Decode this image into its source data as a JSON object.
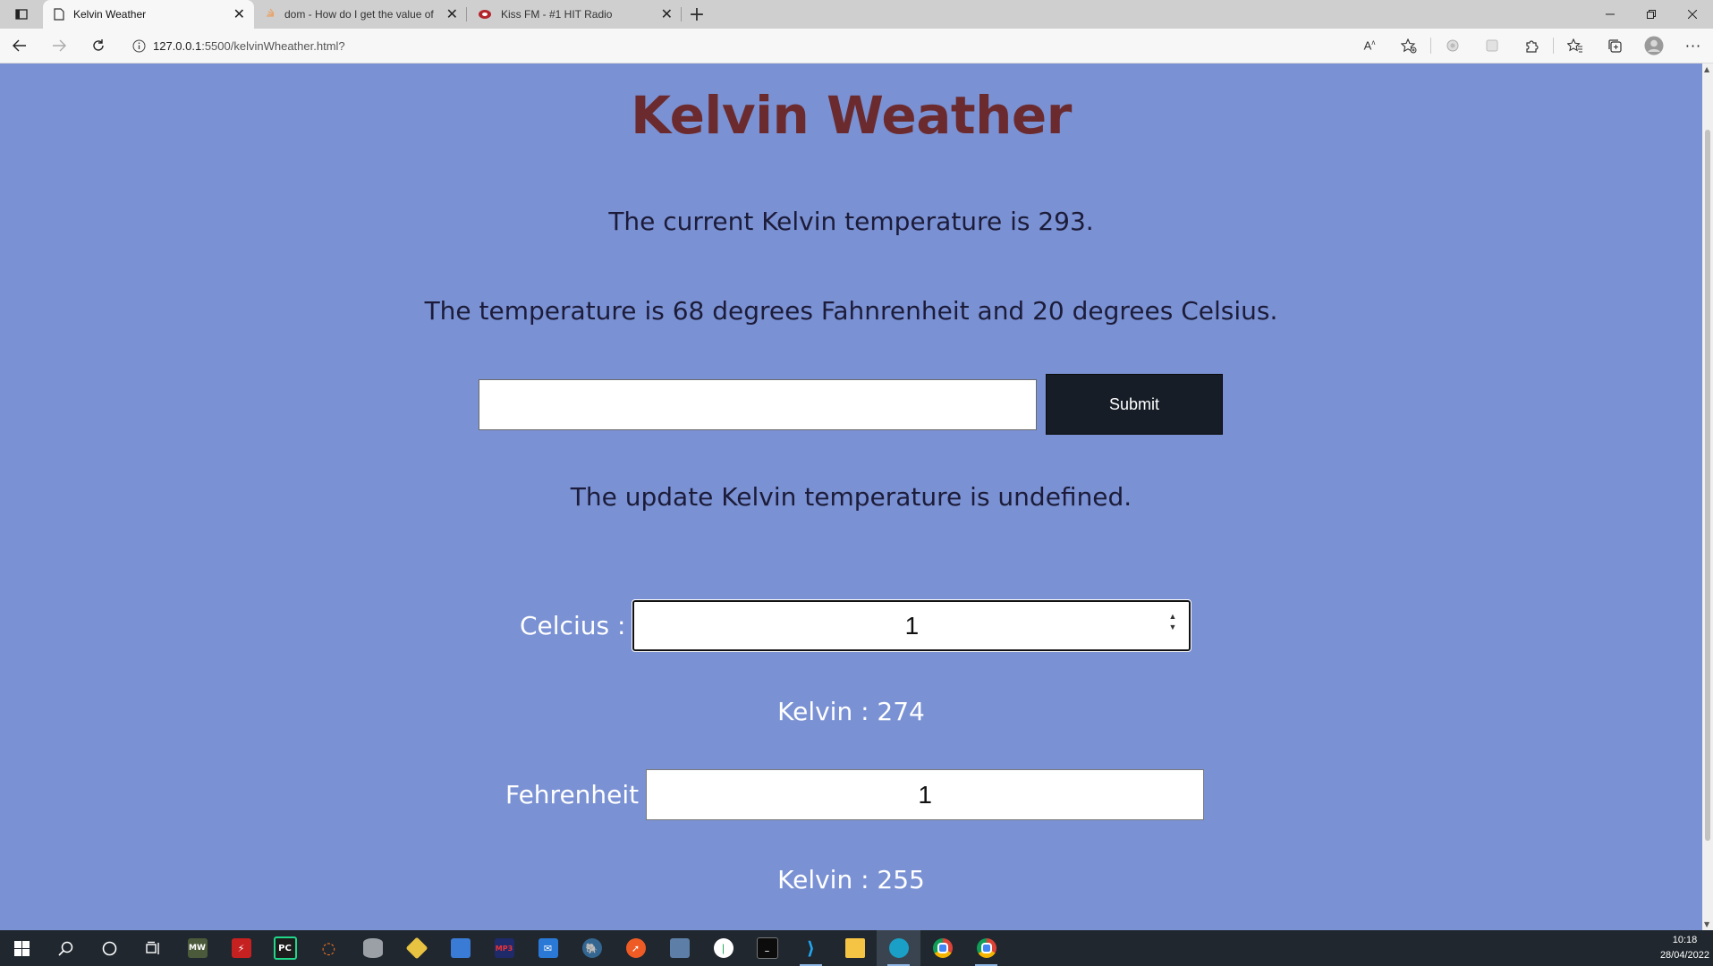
{
  "browser": {
    "tabs": [
      {
        "title": "Kelvin Weather",
        "active": true
      },
      {
        "title": "dom - How do I get the value of",
        "active": false
      },
      {
        "title": "Kiss FM - #1 HIT Radio",
        "active": false
      }
    ],
    "url_host": "127.0.0.1",
    "url_rest": ":5500/kelvinWheather.html?"
  },
  "page": {
    "title": "Kelvin Weather",
    "current_text": "The current Kelvin temperature is 293.",
    "conversion_text": "The temperature is 68 degrees Fahnrenheit and 20 degrees Celsius.",
    "input_value": "",
    "submit_label": "Submit",
    "update_text": "The update Kelvin temperature is undefined.",
    "celsius_label": "Celcius :",
    "celsius_value": "1",
    "kelvin_from_celsius": "Kelvin : 274",
    "fahrenheit_label": "Fehrenheit",
    "fahrenheit_value": "1",
    "kelvin_from_fahrenheit": "Kelvin : 255"
  },
  "taskbar": {
    "time": "10:18",
    "date": "28/04/2022"
  },
  "colors": {
    "page_background": "#7a91d3",
    "title": "#6b2b2e",
    "submit_button": "#161d26",
    "taskbar": "#20272f"
  }
}
